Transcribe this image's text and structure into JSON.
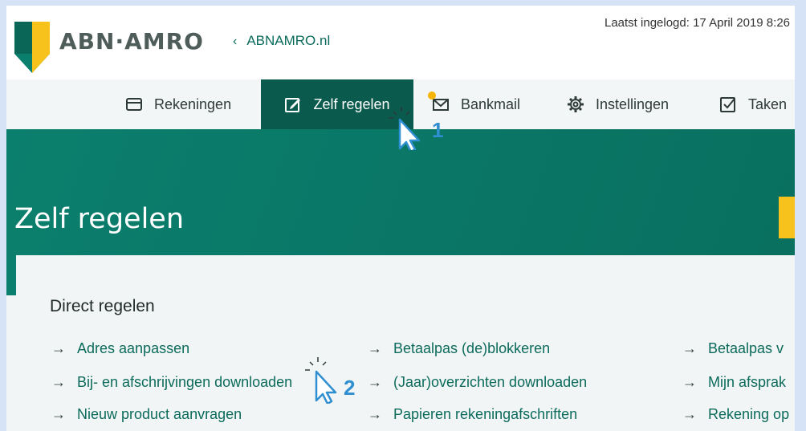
{
  "header": {
    "logo_text": "ABN·AMRO",
    "back_link": "ABNAMRO.nl",
    "last_login": "Laatst ingelogd: 17 April 2019 8:26"
  },
  "nav": {
    "items": [
      {
        "label": "Rekeningen",
        "icon": "card-icon"
      },
      {
        "label": "Zelf regelen",
        "icon": "edit-icon",
        "active": true
      },
      {
        "label": "Bankmail",
        "icon": "mail-icon"
      },
      {
        "label": "Instellingen",
        "icon": "gear-icon"
      },
      {
        "label": "Taken",
        "icon": "checkbox-icon"
      }
    ]
  },
  "banner": {
    "title": "Zelf regelen"
  },
  "content": {
    "section_title": "Direct regelen",
    "links": [
      [
        "Adres aanpassen",
        "Betaalpas (de)blokkeren",
        "Betaalpas v"
      ],
      [
        "Bij- en afschrijvingen downloaden",
        "(Jaar)overzichten downloaden",
        "Mijn afsprak"
      ],
      [
        "Nieuw product aanvragen",
        "Papieren rekeningafschriften",
        "Rekening op"
      ]
    ]
  },
  "annotations": {
    "step1": "1",
    "step2": "2"
  },
  "colors": {
    "brand_green": "#0b7f6d",
    "nav_active": "#0a5a4d",
    "cta_yellow": "#f6c21b",
    "annotation_blue": "#2f8fd0",
    "notification_dot": "#f5b400"
  }
}
